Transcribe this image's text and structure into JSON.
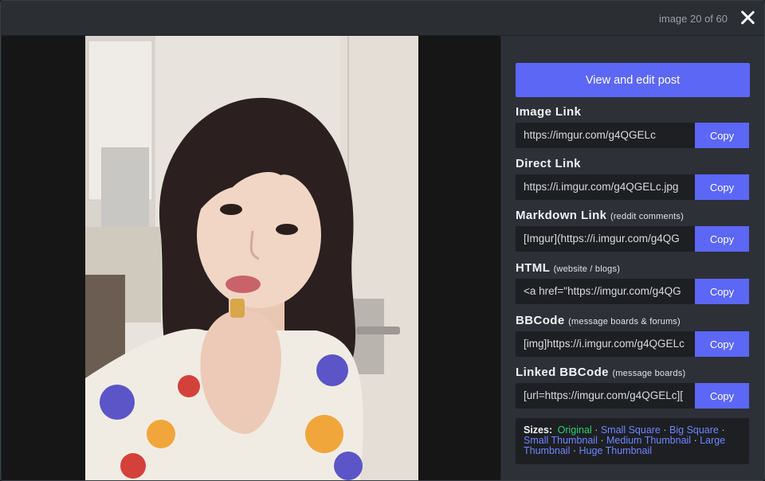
{
  "header": {
    "counter": "image 20 of 60",
    "close_icon": "close-icon"
  },
  "panel": {
    "edit_button": "View and edit post",
    "copy_label": "Copy",
    "fields": [
      {
        "title": "Image Link",
        "subtitle": "",
        "value": "https://imgur.com/g4QGELc"
      },
      {
        "title": "Direct Link",
        "subtitle": "",
        "value": "https://i.imgur.com/g4QGELc.jpg"
      },
      {
        "title": "Markdown Link",
        "subtitle": "(reddit comments)",
        "value": "[Imgur](https://i.imgur.com/g4QG"
      },
      {
        "title": "HTML",
        "subtitle": "(website / blogs)",
        "value": "<a href=\"https://imgur.com/g4QG"
      },
      {
        "title": "BBCode",
        "subtitle": "(message boards & forums)",
        "value": "[img]https://i.imgur.com/g4QGELc"
      },
      {
        "title": "Linked BBCode",
        "subtitle": "(message boards)",
        "value": "[url=https://imgur.com/g4QGELc]["
      }
    ],
    "sizes": {
      "label": "Sizes:",
      "original": "Original",
      "options": [
        "Small Square",
        "Big Square",
        "Small Thumbnail",
        "Medium Thumbnail",
        "Large Thumbnail",
        "Huge Thumbnail"
      ],
      "separator": "·"
    }
  },
  "colors": {
    "accent": "#5c67f6",
    "original_link": "#2dcd6f",
    "size_link": "#6f86ff",
    "panel_bg": "#2d3037"
  }
}
